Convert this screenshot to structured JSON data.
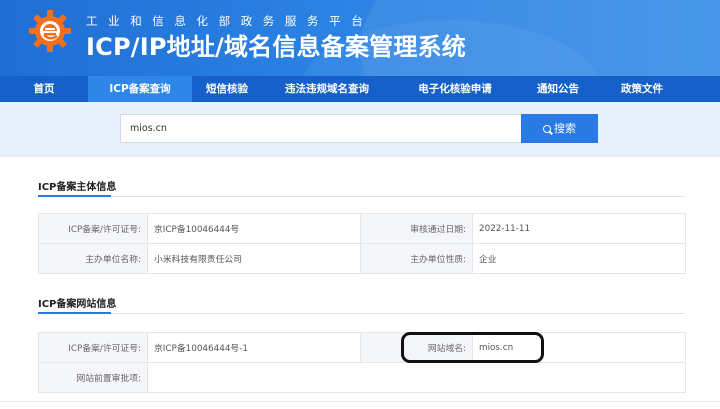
{
  "header": {
    "subtitle": "工业和信息化部政务服务平台",
    "title": "ICP/IP地址/域名信息备案管理系统",
    "logo_icon": "miit-gear-logo-icon",
    "colors": {
      "header_blue": "#2b82e3",
      "nav_blue": "#1560c9",
      "nav_active": "#2e86e8",
      "logo_orange": "#f0701e"
    }
  },
  "nav": {
    "items": [
      {
        "label": "首页",
        "active": false
      },
      {
        "label": "ICP备案查询",
        "active": true
      },
      {
        "label": "短信核验",
        "active": false
      },
      {
        "label": "违法违规域名查询",
        "active": false
      },
      {
        "label": "电子化核验申请",
        "active": false
      },
      {
        "label": "通知公告",
        "active": false
      },
      {
        "label": "政策文件",
        "active": false
      }
    ]
  },
  "search": {
    "value": "mios.cn",
    "button_label": "搜索",
    "button_icon": "search-icon",
    "accent": "#2a7ae4"
  },
  "subject_section": {
    "title": "ICP备案主体信息",
    "rows": [
      {
        "label1": "ICP备案/许可证号:",
        "value1": "京ICP备10046444号",
        "label2": "审核通过日期:",
        "value2": "2022-11-11"
      },
      {
        "label1": "主办单位名称:",
        "value1": "小米科技有限责任公司",
        "label2": "主办单位性质:",
        "value2": "企业"
      }
    ]
  },
  "website_section": {
    "title": "ICP备案网站信息",
    "row1": {
      "label1": "ICP备案/许可证号:",
      "value1": "京ICP备10046444号-1",
      "label2": "网站域名:",
      "value2": "mios.cn"
    },
    "row2": {
      "label1": "网站前置审批项:",
      "value1": ""
    }
  }
}
